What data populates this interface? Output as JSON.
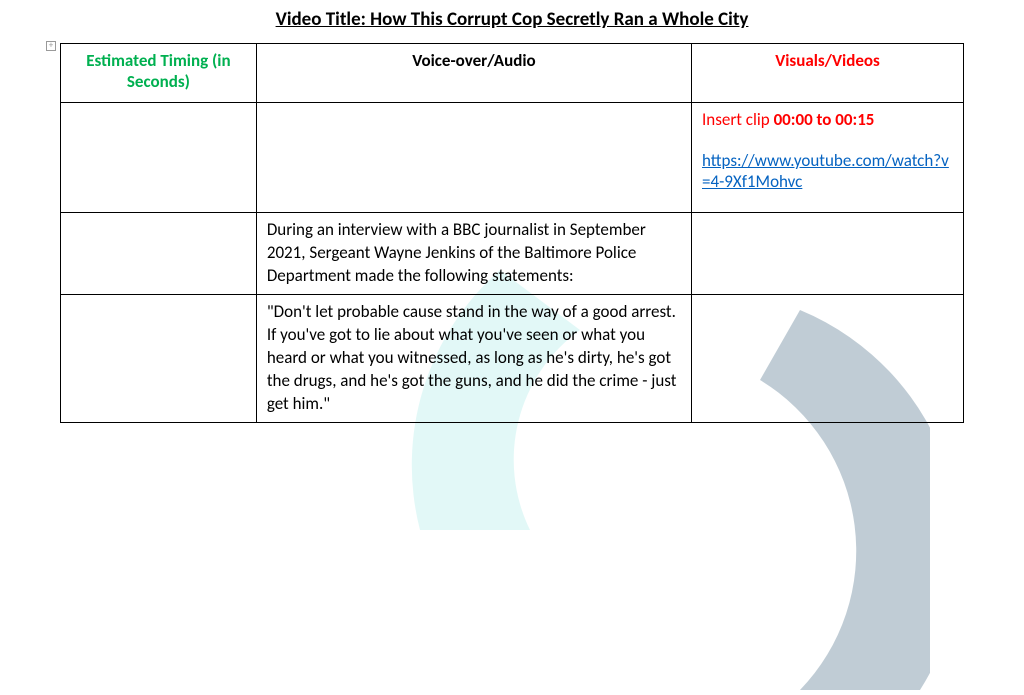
{
  "title": "Video Title: How This Corrupt Cop Secretly Ran a Whole City",
  "headers": {
    "timing": "Estimated Timing (in Seconds)",
    "audio": "Voice-over/Audio",
    "visuals": "Visuals/Videos"
  },
  "rows": [
    {
      "timing": "",
      "audio": "",
      "visual_pre": "Insert clip ",
      "visual_bold": "00:00 to 00:15",
      "visual_link": "https://www.youtube.com/watch?v=4-9Xf1Mohvc"
    },
    {
      "timing": "",
      "audio": "During an interview with a BBC journalist in September 2021, Sergeant Wayne Jenkins of the Baltimore Police Department made the following statements:",
      "visual_pre": "",
      "visual_bold": "",
      "visual_link": ""
    },
    {
      "timing": "",
      "audio": "\"Don't let probable cause stand in the way of a good arrest. If you've got to lie about what you've seen or what you heard or what you witnessed, as long as he's dirty, he's got the drugs, and he's got the guns, and he did the crime - just get him.\"",
      "visual_pre": "",
      "visual_bold": "",
      "visual_link": ""
    }
  ]
}
